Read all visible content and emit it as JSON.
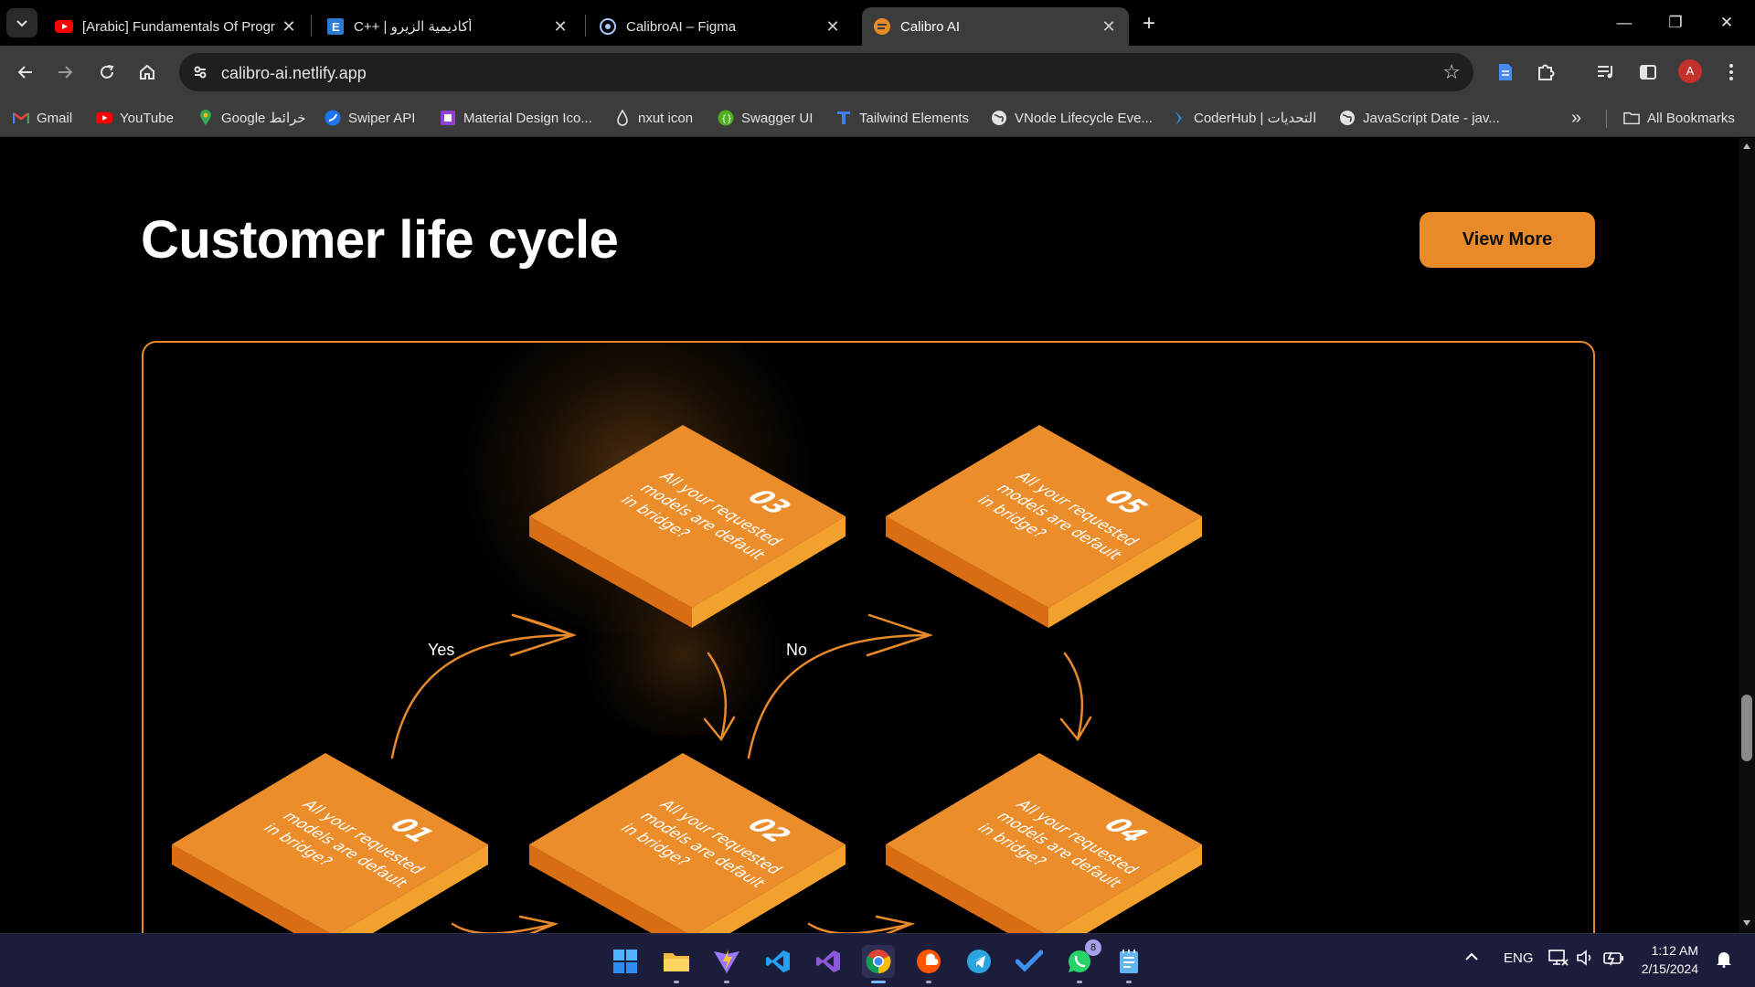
{
  "browser": {
    "tabs": [
      {
        "title": "[Arabic] Fundamentals Of Progr",
        "favicon": "youtube-icon",
        "active": false
      },
      {
        "title": "C++ | أكاديمية الزيرو",
        "favicon": "e-icon",
        "active": false
      },
      {
        "title": "CalibroAI – Figma",
        "favicon": "calibro-figma-icon",
        "active": false
      },
      {
        "title": "Calibro AI",
        "favicon": "calibro-icon",
        "active": true
      }
    ],
    "url": "calibro-ai.netlify.app",
    "profile_initial": "A",
    "bookmarks": [
      {
        "label": "Gmail",
        "icon": "gmail-icon"
      },
      {
        "label": "YouTube",
        "icon": "youtube-icon"
      },
      {
        "label": "Google خرائط",
        "icon": "maps-icon"
      },
      {
        "label": "Swiper API",
        "icon": "swiper-icon"
      },
      {
        "label": "Material Design Ico...",
        "icon": "material-icon"
      },
      {
        "label": "nxut icon",
        "icon": "drop-icon"
      },
      {
        "label": "Swagger UI",
        "icon": "swagger-icon"
      },
      {
        "label": "Tailwind Elements",
        "icon": "tailwind-elements-icon"
      },
      {
        "label": "VNode Lifecycle Eve...",
        "icon": "globe-icon"
      },
      {
        "label": "CoderHub | التحديات",
        "icon": "coderhub-icon"
      },
      {
        "label": "JavaScript Date - jav...",
        "icon": "globe-icon"
      }
    ],
    "all_bookmarks_label": "All Bookmarks"
  },
  "page": {
    "title": "Customer life cycle",
    "view_more_label": "View More",
    "cycle": {
      "steps": [
        {
          "number": "01",
          "lines": [
            "All your requested",
            "models are default",
            "in bridge?"
          ]
        },
        {
          "number": "02",
          "lines": [
            "All your requested",
            "models are default",
            "in bridge?"
          ]
        },
        {
          "number": "03",
          "lines": [
            "All your requested",
            "models are default",
            "in bridge?"
          ]
        },
        {
          "number": "04",
          "lines": [
            "All your requested",
            "models are default",
            "in bridge?"
          ]
        },
        {
          "number": "05",
          "lines": [
            "All your requested",
            "models are default",
            "in bridge?"
          ]
        }
      ],
      "yes_label": "Yes",
      "no_label": "No"
    },
    "colors": {
      "accent": "#e8892a",
      "tile_top": "#ec8d2c",
      "tile_side": "#d96d13",
      "tile_edge": "#f2a12d"
    }
  },
  "taskbar": {
    "apps": [
      {
        "name": "start",
        "icon": "windows-icon"
      },
      {
        "name": "file-explorer",
        "icon": "folder-icon"
      },
      {
        "name": "vite",
        "icon": "vite-icon"
      },
      {
        "name": "vs-code",
        "icon": "vscode-icon"
      },
      {
        "name": "visual-studio",
        "icon": "visual-studio-icon"
      },
      {
        "name": "chrome",
        "icon": "chrome-icon"
      },
      {
        "name": "soundcloud",
        "icon": "soundcloud-icon"
      },
      {
        "name": "telegram",
        "icon": "telegram-icon"
      },
      {
        "name": "todo",
        "icon": "check-icon"
      },
      {
        "name": "whatsapp",
        "icon": "whatsapp-icon",
        "badge": "8"
      },
      {
        "name": "notepad",
        "icon": "notepad-icon"
      }
    ],
    "language": "ENG",
    "time": "1:12 AM",
    "date": "2/15/2024"
  }
}
